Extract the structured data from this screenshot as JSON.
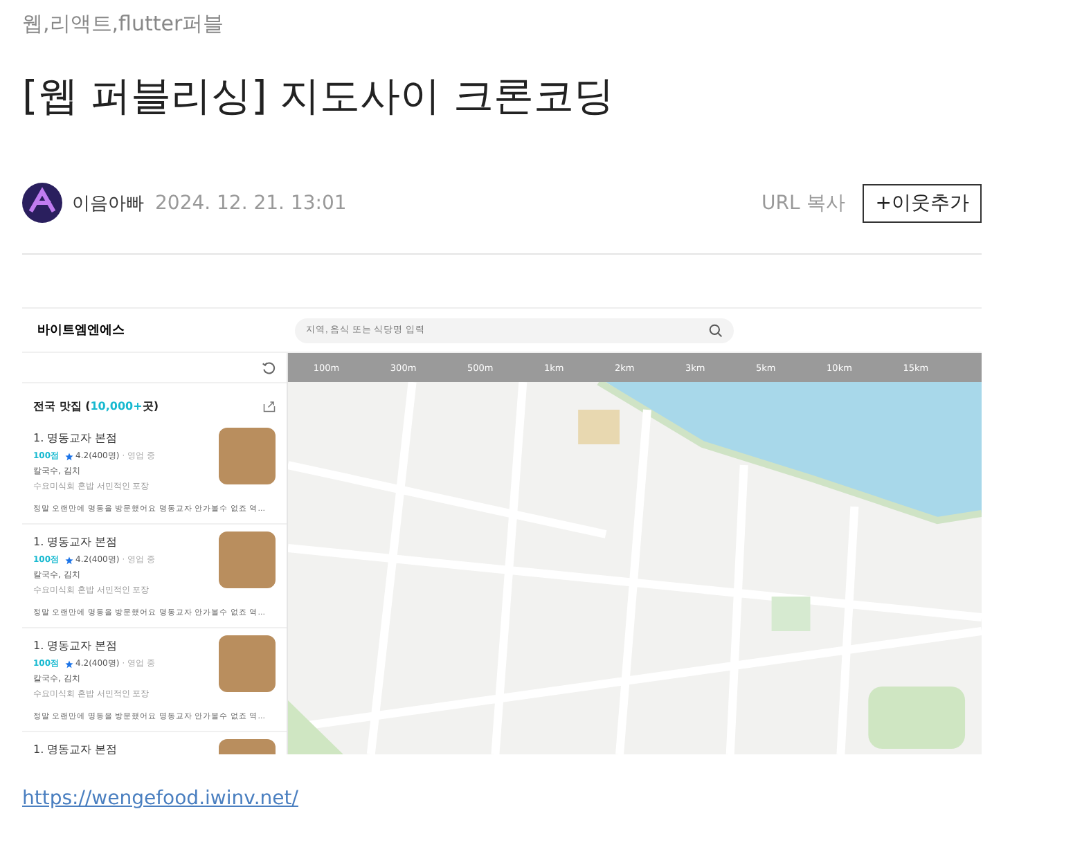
{
  "category": "웹,리액트,flutter퍼블",
  "title": "[웹 퍼블리싱] 지도사이 크론코딩",
  "author": {
    "name": "이음아빠",
    "date": "2024. 12. 21. 13:01"
  },
  "actions": {
    "copy_url": "URL 복사",
    "add_neighbor": "+이웃추가"
  },
  "embed": {
    "brand": "바이트엠엔에스",
    "search": {
      "placeholder": "지역, 음식 또는 식당명 입력"
    },
    "list_header": {
      "title": "전국 맛집",
      "count_open": "(",
      "count": "10,000+",
      "count_close": "곳)"
    },
    "restaurants": [
      {
        "name": "1. 명동교자 본점",
        "score": "100점",
        "rating": "4.2(400명)",
        "status": "· 영업 중",
        "menu": "칼국수, 김치",
        "tags": "수요미식회 혼밥 서민적인 포장",
        "review": "정말 오랜만에 명동을 방문했어요 명동교자 안가볼수 없죠 역..."
      },
      {
        "name": "1. 명동교자 본점",
        "score": "100점",
        "rating": "4.2(400명)",
        "status": "· 영업 중",
        "menu": "칼국수, 김치",
        "tags": "수요미식회 혼밥 서민적인 포장",
        "review": "정말 오랜만에 명동을 방문했어요 명동교자 안가볼수 없죠 역..."
      },
      {
        "name": "1. 명동교자 본점",
        "score": "100점",
        "rating": "4.2(400명)",
        "status": "· 영업 중",
        "menu": "칼국수, 김치",
        "tags": "수요미식회 혼밥 서민적인 포장",
        "review": "정말 오랜만에 명동을 방문했어요 명동교자 안가볼수 없죠 역..."
      },
      {
        "name": "1. 명동교자 본점"
      }
    ],
    "scales": [
      "100m",
      "300m",
      "500m",
      "1km",
      "2km",
      "3km",
      "5km",
      "10km",
      "15km"
    ]
  },
  "link": "https://wengefood.iwinv.net/"
}
